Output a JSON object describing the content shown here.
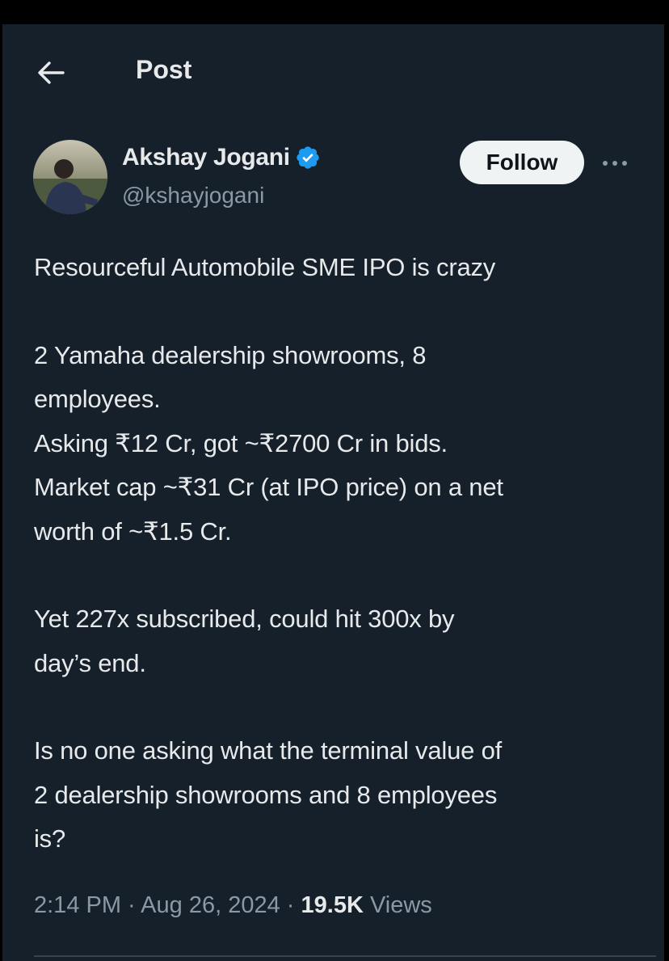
{
  "header": {
    "back_icon": "arrow-left-icon",
    "title": "Post"
  },
  "author": {
    "name": "Akshay Jogani",
    "handle": "@kshayjogani",
    "verified_icon": "verified-badge-icon",
    "verified_color": "#1d9bf0"
  },
  "actions": {
    "follow_label": "Follow",
    "more_icon": "more-horizontal-icon"
  },
  "post": {
    "paragraphs": [
      "Resourceful Automobile SME IPO is crazy",
      "2 Yamaha dealership showrooms, 8\nemployees.\nAsking ₹12 Cr, got ~₹2700 Cr in bids.\nMarket cap ~₹31 Cr (at IPO price) on a net\nworth of ~₹1.5 Cr.",
      "Yet 227x subscribed, could hit 300x by\nday’s end.",
      "Is no one asking what the terminal value of\n2 dealership showrooms and 8 employees\nis?"
    ]
  },
  "meta": {
    "time": "2:14 PM",
    "separator": " · ",
    "date": "Aug 26, 2024",
    "views_count": "19.5K",
    "views_label": "Views"
  },
  "colors": {
    "background": "#15202b",
    "text": "#e7e9ea",
    "secondary": "#8b98a5",
    "accent": "#1d9bf0"
  }
}
